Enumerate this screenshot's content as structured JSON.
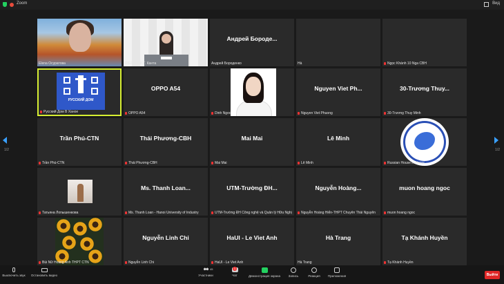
{
  "topbar": {
    "title": "Zoom",
    "view_label": "Вид"
  },
  "nav": {
    "left_page": "1/2",
    "right_page": "1/2"
  },
  "tiles": [
    {
      "name": "Elena Осуратова",
      "display": ""
    },
    {
      "name": "RIEF им. И.Г. Канта",
      "display": ""
    },
    {
      "name": "Андрей Бороденко",
      "display": "Андрей Бороде..."
    },
    {
      "name": "Hà",
      "display": ""
    },
    {
      "name": "Ngọc Khánh 10 Nga CBH",
      "display": ""
    },
    {
      "name": "Русский Дом В Ханое",
      "display": ""
    },
    {
      "name": "OPPO A54",
      "display": "OPPO A54"
    },
    {
      "name": "Dinh Ngoc",
      "display": ""
    },
    {
      "name": "Nguyen Viet Phuong",
      "display": "Nguyen Viet Ph..."
    },
    {
      "name": "30-Trương Thuy Minh",
      "display": "30-Trương Thuy..."
    },
    {
      "name": "Trần Phú-CTN",
      "display": "Trần Phú-CTN"
    },
    {
      "name": "Thái Phương-CBH",
      "display": "Thái Phương-CBH"
    },
    {
      "name": "Mai Mai",
      "display": "Mai Mai"
    },
    {
      "name": "Lê Minh",
      "display": "Lê Minh"
    },
    {
      "name": "Russian House in Hanoi",
      "display": ""
    },
    {
      "name": "Татьяна Лопышенкова",
      "display": ""
    },
    {
      "name": "Ms. Thanh Loan - Hanoi University of Industry",
      "display": "Ms. Thanh Loan..."
    },
    {
      "name": "UTM-Trường ĐH Công nghệ và Quản lý Hữu Nghị",
      "display": "UTM-Trường ĐH..."
    },
    {
      "name": "Nguyễn Hoàng Hiển-THPT Chuyên Thái Nguyên",
      "display": "Nguyễn Hoàng..."
    },
    {
      "name": "muon hoang ngoc",
      "display": "muon hoang ngoc"
    },
    {
      "name": "Bùi Nữ Hoàng Anh THPT CTN",
      "display": ""
    },
    {
      "name": "Nguyễn Linh Chi",
      "display": "Nguyễn Linh Chi"
    },
    {
      "name": "HaUI - Le Viet Anh",
      "display": "HaUI - Le Viet Anh"
    },
    {
      "name": "Hà Trang",
      "display": "Hà Trang"
    },
    {
      "name": "Tạ Khánh Huyền",
      "display": "Tạ Khánh Huyền"
    }
  ],
  "logo_text": "РУССКИЙ ДОМ",
  "toolbar": {
    "mute": "Выключить звук",
    "video": "Остановить видео",
    "participants": "Участники",
    "participants_count": "45",
    "chat": "Чат",
    "chat_badge": "1",
    "share": "Демонстрация экрана",
    "record": "Запись",
    "reactions": "Реакция",
    "apps": "Приложения",
    "leave": "Выйти"
  }
}
